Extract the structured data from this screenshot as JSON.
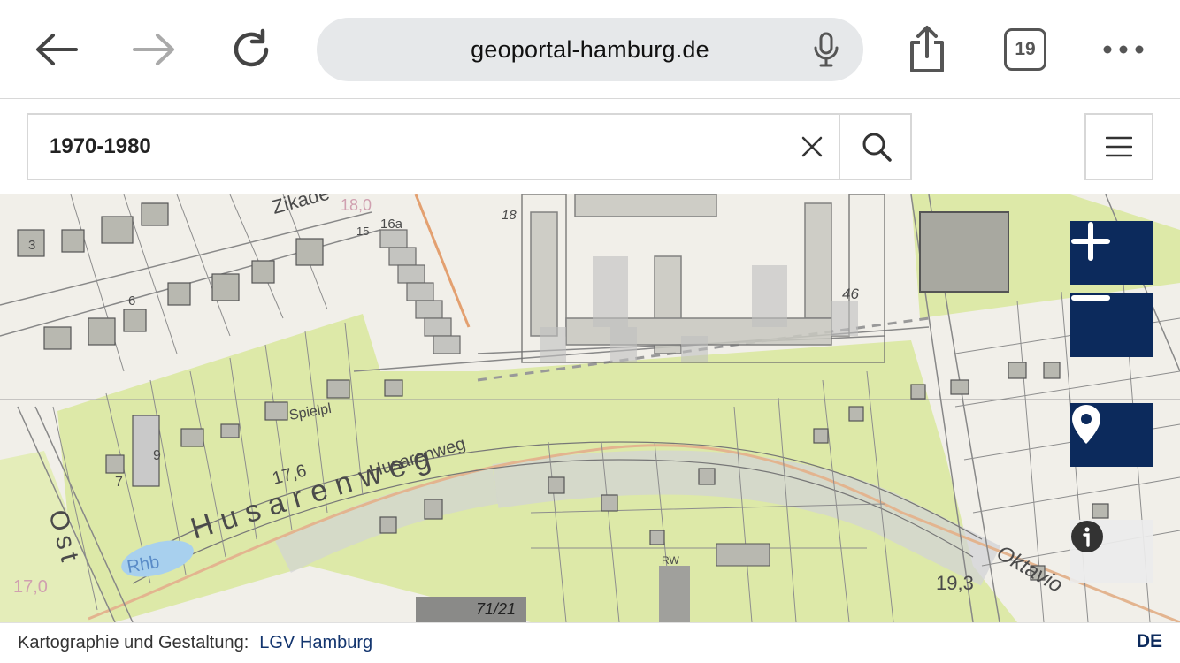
{
  "browser": {
    "url": "geoportal-hamburg.de",
    "tab_count": "19"
  },
  "search": {
    "value": "1970-1980"
  },
  "map": {
    "labels": {
      "street_1": "Husarenweg",
      "street_2": "Husarenweg",
      "street_3": "Zikade",
      "street_4": "Oktavio",
      "street_5": "Ost",
      "area_label": "Spielpl",
      "water_label": "Rhb",
      "elevation_1": "17,6",
      "elevation_2": "19,3",
      "elevation_3": "17,0",
      "elevation_4": "18,0",
      "house_16": "16a",
      "house_15": "15",
      "house_18": "18",
      "house_46": "46",
      "house_7": "7",
      "house_9": "9",
      "house_71": "71/21",
      "house_bw": "RW",
      "house_6": "6",
      "house_3": "3"
    },
    "colors": {
      "green_area": "#dde9a8",
      "ctrl_dark": "#0c2a5c"
    }
  },
  "footer": {
    "credit_label": "Kartographie und Gestaltung:",
    "credit_link": "LGV Hamburg",
    "language": "DE"
  }
}
